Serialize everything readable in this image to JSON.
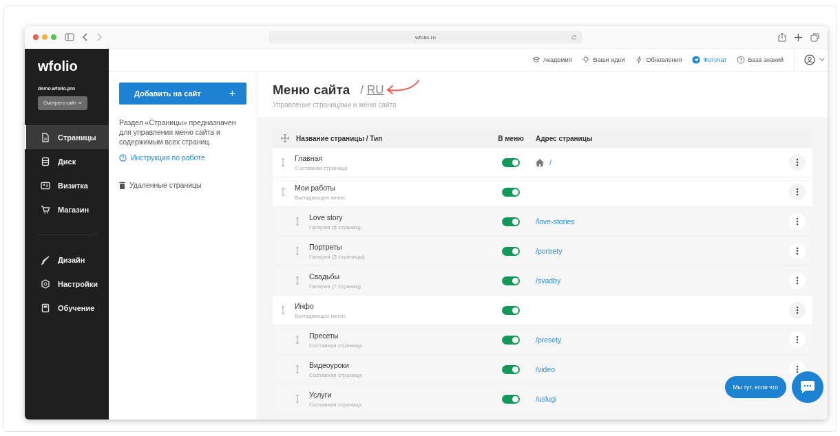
{
  "browser": {
    "url": "wfolio.ru"
  },
  "sidebar": {
    "logo": "wfolio",
    "site": "demo.wfolio.pro",
    "view_button": "Смотреть сайт ➞",
    "items": [
      {
        "label": "Страницы",
        "selected": true,
        "group_start": false
      },
      {
        "label": "Диск",
        "selected": false,
        "group_start": false
      },
      {
        "label": "Визитка",
        "selected": false,
        "group_start": false
      },
      {
        "label": "Магазин",
        "selected": false,
        "group_start": false
      },
      {
        "label": "Дизайн",
        "selected": false,
        "group_start": true
      },
      {
        "label": "Настройки",
        "selected": false,
        "group_start": false
      },
      {
        "label": "Обучение",
        "selected": false,
        "group_start": false
      }
    ]
  },
  "topbar": {
    "links": [
      {
        "label": "Академия",
        "highlighted": false
      },
      {
        "label": "Ваши идеи",
        "highlighted": false
      },
      {
        "label": "Обновления",
        "highlighted": false
      },
      {
        "label": "Фоточат",
        "highlighted": true
      },
      {
        "label": "База знаний",
        "highlighted": false
      }
    ]
  },
  "left_panel": {
    "add_button": "Добавить на сайт",
    "add_icon": "+",
    "description": "Раздел «Страницы» предназначен для управления меню сайта и содержимым всех страниц.",
    "help_link": "Инструкция по работе",
    "deleted_link": "Удаленные страницы"
  },
  "header": {
    "title": "Меню сайта",
    "separator": "/",
    "language": "RU",
    "subtitle": "Управление страницами и меню сайта"
  },
  "table": {
    "columns": [
      "Название страницы / Тип",
      "В меню",
      "Адрес страницы"
    ],
    "pages": [
      {
        "name": "Главная",
        "type": "Составная страница",
        "in_menu": true,
        "home": true,
        "address": "/"
      },
      {
        "name": "Мои работы",
        "type": "Выпадающее меню",
        "in_menu": true,
        "children": [
          {
            "name": "Love story",
            "type": "Галерея (6 страниц)",
            "in_menu": true,
            "address": "/love-stories"
          },
          {
            "name": "Портреты",
            "type": "Галерея (3 страницы)",
            "in_menu": true,
            "address": "/portrety"
          },
          {
            "name": "Свадьбы",
            "type": "Галерея (7 страниц)",
            "in_menu": true,
            "address": "/svadby"
          }
        ]
      },
      {
        "name": "Инфо",
        "type": "Выпадающее меню",
        "in_menu": true,
        "children": [
          {
            "name": "Пресеты",
            "type": "Составная страница",
            "in_menu": true,
            "address": "/presety"
          },
          {
            "name": "Видеоуроки",
            "type": "Составная страница",
            "in_menu": true,
            "address": "/video"
          },
          {
            "name": "Услуги",
            "type": "Составная страница",
            "in_menu": true,
            "address": "/uslugi"
          }
        ]
      }
    ]
  },
  "chat": {
    "bubble": "Мы тут, если что"
  }
}
